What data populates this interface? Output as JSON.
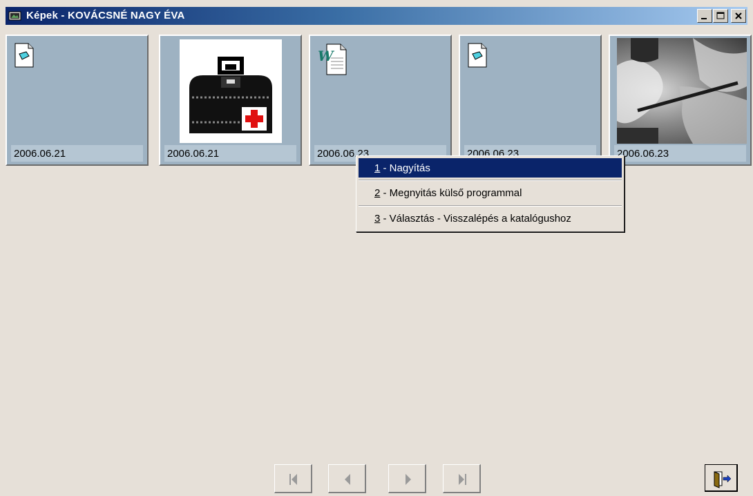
{
  "window": {
    "title": "Képek - KOVÁCSNÉ NAGY ÉVA",
    "controls": [
      "minimize",
      "maximize",
      "close"
    ]
  },
  "thumbnails": [
    {
      "date": "2006.06.21",
      "icon": "generic-document-icon"
    },
    {
      "date": "2006.06.21",
      "icon": "medical-bag-image"
    },
    {
      "date": "2006.06.23",
      "icon": "word-document-icon"
    },
    {
      "date": "2006.06.23",
      "icon": "generic-document-icon"
    },
    {
      "date": "2006.06.23",
      "icon": "grayscale-photo"
    }
  ],
  "context_menu": {
    "items": [
      {
        "key": "1",
        "label": " - Nagyítás",
        "active": true
      },
      {
        "key": "2",
        "label": " - Megnyitás külső programmal",
        "active": false
      },
      {
        "key": "3",
        "label": " - Választás - Visszalépés a katalógushoz",
        "active": false
      }
    ]
  },
  "navigation": {
    "buttons": [
      "first-record-icon",
      "previous-record-icon",
      "next-record-icon",
      "last-record-icon"
    ],
    "exit": "exit-door-icon"
  },
  "colors": {
    "title_start": "#0a246a",
    "title_end": "#a6caf0",
    "thumb_bg": "#9eb2c2",
    "menu_highlight": "#0a246a",
    "window_bg": "#e6e0d8"
  }
}
